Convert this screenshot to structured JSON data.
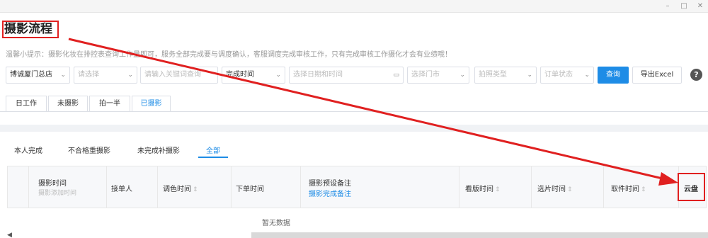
{
  "window": {
    "minimize": "–",
    "maximize": "□",
    "close": "✕"
  },
  "page": {
    "title": "摄影流程",
    "tip": "温馨小提示：摄影化妆在排控表查询工作量即可，服务全部完成要与调度确认，客服调度完成审核工作，只有完成审核工作摄化才会有业绩哦！"
  },
  "filters": {
    "store": "博诚厦门总店",
    "select": "请选择",
    "keyword_placeholder": "请输入关键词查询",
    "time_type": "完成时间",
    "date_placeholder": "选择日期和时间",
    "city_placeholder": "选择门市",
    "shoot_type_placeholder": "拍照类型",
    "order_status_placeholder": "订单状态",
    "query_label": "查询",
    "export_label": "导出Excel",
    "help": "?"
  },
  "tabs": [
    "日工作",
    "未摄影",
    "拍一半",
    "已摄影"
  ],
  "active_tab": "已摄影",
  "subtabs": [
    "本人完成",
    "不合格重摄影",
    "未完成补摄影",
    "全部"
  ],
  "active_subtab": "全部",
  "table": {
    "col_shoot_time": "摄影时间",
    "col_shoot_added": "摄影添加时间",
    "col_receiver": "接单人",
    "col_color_time": "调色时间",
    "col_order_time": "下单时间",
    "col_preset_note": "摄影预设备注",
    "col_done_note": "摄影完成备注",
    "col_layout_time": "看版时间",
    "col_select_time": "选片时间",
    "col_pickup_time": "取件时间",
    "col_cloud": "云盘",
    "empty_text": "暂无数据"
  },
  "colors": {
    "accent": "#1e8ce6",
    "annotation": "#e02020"
  },
  "icons": {
    "dropdown": "chevron-down-icon",
    "date": "calendar-icon",
    "sort": "sort-icon",
    "help": "question-icon"
  }
}
